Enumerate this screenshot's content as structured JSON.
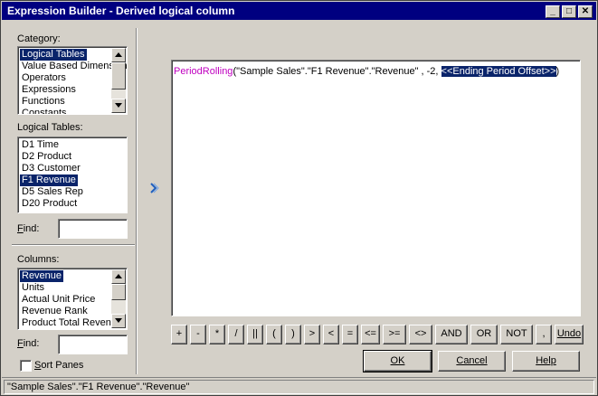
{
  "window": {
    "title": "Expression Builder - Derived logical column",
    "minimize": "_",
    "maximize": "□",
    "close": "✕"
  },
  "category": {
    "label": "Category:",
    "items": [
      "Logical Tables",
      "Value Based Dimensions",
      "Operators",
      "Expressions",
      "Functions",
      "Constants"
    ],
    "selected_index": 0
  },
  "logical_tables": {
    "label": "Logical Tables:",
    "items": [
      "D1 Time",
      "D2 Product",
      "D3 Customer",
      "F1 Revenue",
      "D5 Sales Rep",
      "D20 Product"
    ],
    "selected_index": 3
  },
  "find_tables": {
    "label": "Find:",
    "value": ""
  },
  "columns": {
    "label": "Columns:",
    "items": [
      "Revenue",
      "Units",
      "Actual Unit Price",
      "Revenue Rank",
      "Product Total Revenue"
    ],
    "selected_index": 0
  },
  "find_columns": {
    "label": "Find:",
    "value": ""
  },
  "sort_panes": {
    "label": "Sort Panes",
    "checked": false
  },
  "insert_icon": "chevron-right-double-icon",
  "expression": {
    "function": "PeriodRolling",
    "args": "(\"Sample Sales\".\"F1 Revenue\".\"Revenue\" , -2, ",
    "highlight": "<<Ending Period Offset>>",
    "close": ")"
  },
  "operators": [
    "+",
    "-",
    "*",
    "/",
    "||",
    "(",
    ")",
    ">",
    "<",
    "=",
    "<=",
    ">=",
    "<>",
    "AND",
    "OR",
    "NOT",
    ",",
    "Undo"
  ],
  "buttons": {
    "ok": "OK",
    "cancel": "Cancel",
    "help": "Help"
  },
  "status": "\"Sample Sales\".\"F1 Revenue\".\"Revenue\"",
  "colors": {
    "title_bar": "#000080",
    "selection": "#0a246a",
    "function_text": "#c000c0",
    "insert_arrow": "#1f5fbf"
  }
}
